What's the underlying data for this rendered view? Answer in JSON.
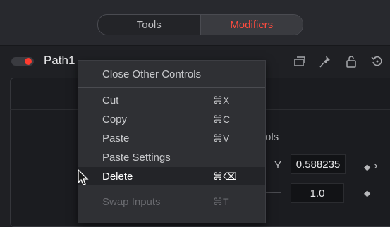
{
  "tabs": [
    {
      "label": "Tools",
      "active": false
    },
    {
      "label": "Modifiers",
      "active": true
    }
  ],
  "header": {
    "node_name": "Path1",
    "icons": [
      "layers-icon",
      "pin-icon",
      "lock-icon",
      "reset-icon"
    ]
  },
  "inspector": {
    "section_label_fragment": "ols",
    "y_label": "Y",
    "y_value": "0.588235",
    "second_value": "1.0"
  },
  "context_menu": {
    "items": [
      {
        "label": "Close Other Controls",
        "shortcut": "",
        "state": "normal"
      },
      {
        "label": "Cut",
        "shortcut": "⌘X",
        "state": "normal"
      },
      {
        "label": "Copy",
        "shortcut": "⌘C",
        "state": "normal"
      },
      {
        "label": "Paste",
        "shortcut": "⌘V",
        "state": "normal"
      },
      {
        "label": "Paste Settings",
        "shortcut": "",
        "state": "normal"
      },
      {
        "label": "Delete",
        "shortcut": "⌘⌫",
        "state": "highlighted"
      },
      {
        "label": "Swap Inputs",
        "shortcut": "⌘T",
        "state": "disabled"
      }
    ]
  },
  "colors": {
    "accent": "#ff4b3e",
    "toggle_dot": "#ff3b2f"
  }
}
